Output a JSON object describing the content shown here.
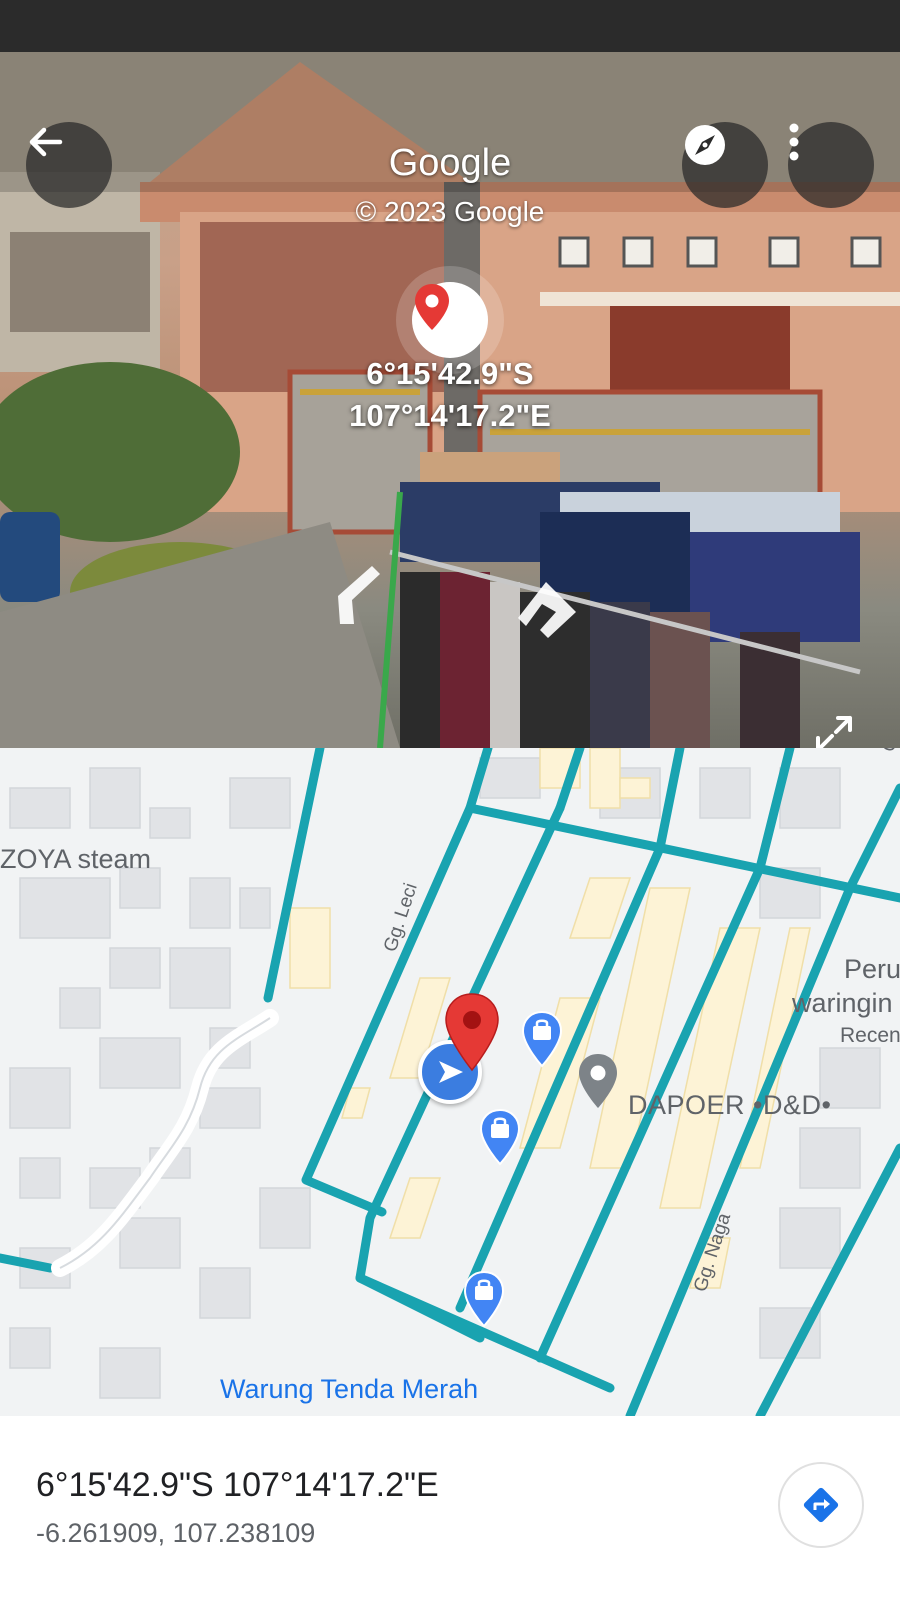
{
  "street_view": {
    "title": "Google",
    "copyright": "© 2023 Google",
    "coord_line1": "6°15'42.9\"S",
    "coord_line2": "107°14'17.2\"E",
    "icons": {
      "back": "arrow-left-icon",
      "compass": "compass-icon",
      "more": "more-vert-icon",
      "pin": "location-pin-icon",
      "expand": "expand-icon",
      "nav_left": "chevron-left-icon",
      "nav_right": "chevron-right-icon"
    }
  },
  "map": {
    "labels": {
      "zoya": "ZOYA steam",
      "leci": "Gg. Leci",
      "naga": "Gg. Naga",
      "dapoer": "DAPOER •D&D•",
      "warung": "Warung Tenda Merah",
      "peru": "Peru",
      "waringin": "waringin",
      "recen": "Recen",
      "edge_tr": "Gg"
    },
    "colors": {
      "road": "#19a3b0",
      "building": "#e1e3e6",
      "highlight": "#fdf3d6",
      "pin": "#e53935",
      "nav": "#3b7de0",
      "shop": "#4285f4",
      "link": "#1a73e8"
    }
  },
  "info": {
    "coordinates": "6°15'42.9\"S 107°14'17.2\"E",
    "decimal": "-6.261909, 107.238109",
    "directions_icon": "directions-icon"
  }
}
